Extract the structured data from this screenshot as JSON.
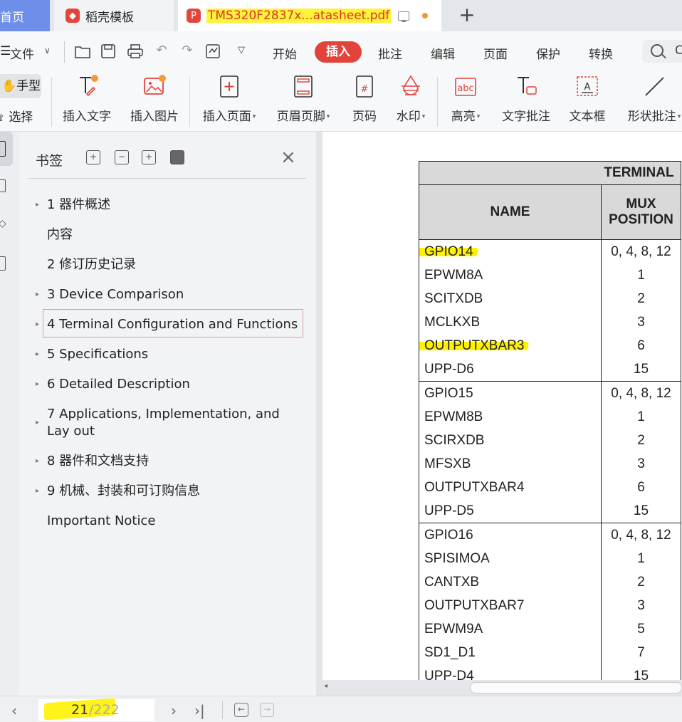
{
  "tabs": {
    "home": "首页",
    "templates": "稻壳模板",
    "document": "TMS320F2837x...atasheet.pdf",
    "new_tab": "+"
  },
  "menu": {
    "file": "文件",
    "items": [
      "开始",
      "插入",
      "批注",
      "编辑",
      "页面",
      "保护",
      "转换"
    ],
    "active": "插入",
    "search_partial": "C"
  },
  "ribbon": {
    "hand_mode": "手型",
    "select_mode": "选择",
    "buttons": [
      "插入文字",
      "插入图片",
      "插入页面",
      "页眉页脚",
      "页码",
      "水印",
      "高亮",
      "文字批注",
      "文本框",
      "形状批注"
    ]
  },
  "bookmarks": {
    "title": "书签",
    "items": [
      {
        "label": "1  器件概述",
        "expandable": true
      },
      {
        "label": "内容",
        "expandable": false
      },
      {
        "label": "2  修订历史记录",
        "expandable": false
      },
      {
        "label": "3  Device Comparison",
        "expandable": true
      },
      {
        "label": "4  Terminal Configuration and Functions",
        "expandable": true,
        "selected": true
      },
      {
        "label": "5  Specifications",
        "expandable": true
      },
      {
        "label": "6  Detailed Description",
        "expandable": true
      },
      {
        "label": "7  Applications, Implementation, and Lay out",
        "expandable": true
      },
      {
        "label": "8  器件和文档支持",
        "expandable": true
      },
      {
        "label": "9  机械、封装和可订购信息",
        "expandable": true
      },
      {
        "label": "Important Notice",
        "expandable": false
      }
    ]
  },
  "table": {
    "group_header": "TERMINAL",
    "col_name": "NAME",
    "col_mux_line1": "MUX",
    "col_mux_line2": "POSITION",
    "groups": [
      {
        "names": [
          "GPIO14",
          "EPWM8A",
          "SCITXDB",
          "MCLKXB",
          "OUTPUTXBAR3",
          "UPP-D6"
        ],
        "mux": [
          "0, 4, 8, 12",
          "1",
          "2",
          "3",
          "6",
          "15"
        ]
      },
      {
        "names": [
          "GPIO15",
          "EPWM8B",
          "SCIRXDB",
          "MFSXB",
          "OUTPUTXBAR4",
          "UPP-D5"
        ],
        "mux": [
          "0, 4, 8, 12",
          "1",
          "2",
          "3",
          "6",
          "15"
        ]
      },
      {
        "names": [
          "GPIO16",
          "SPISIMOA",
          "CANTXB",
          "OUTPUTXBAR7",
          "EPWM9A",
          "SD1_D1",
          "UPP-D4"
        ],
        "mux": [
          "0, 4, 8, 12",
          "1",
          "2",
          "3",
          "5",
          "7",
          "15"
        ]
      }
    ],
    "highlighted": [
      "GPIO14",
      "OUTPUTXBAR3"
    ]
  },
  "status": {
    "current_page": "21",
    "total_pages": "/222"
  },
  "colors": {
    "accent_red": "#e2433b",
    "highlight_yellow": "#fff200",
    "home_tab_blue": "#6d8fe9"
  }
}
